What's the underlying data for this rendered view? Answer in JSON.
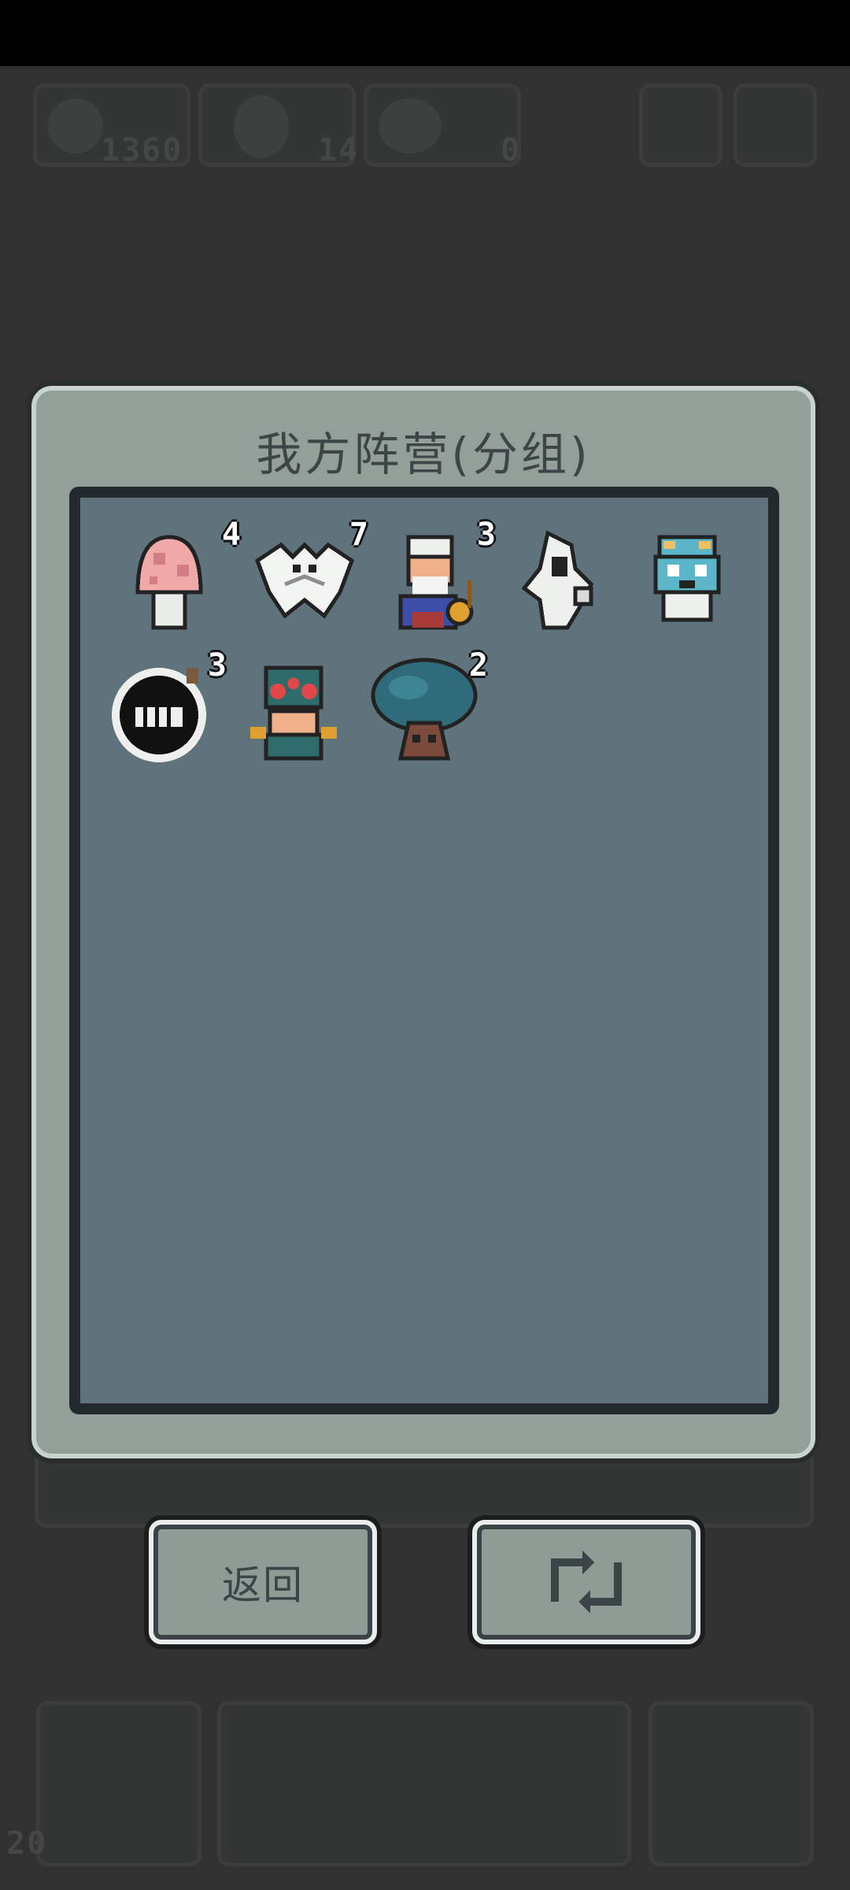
{
  "hud": {
    "resource_1": "1360",
    "resource_2": "14",
    "resource_3": "0",
    "turn_counter": "20"
  },
  "modal": {
    "title": "我方阵营(分组)"
  },
  "units": [
    {
      "name": "pink-mushroom",
      "count": "4"
    },
    {
      "name": "white-bat-spirit",
      "count": "7"
    },
    {
      "name": "old-bard",
      "count": "3"
    },
    {
      "name": "white-ghost-warrior",
      "count": ""
    },
    {
      "name": "blue-fish-creature",
      "count": ""
    },
    {
      "name": "black-bomb",
      "count": "3"
    },
    {
      "name": "teal-spider-mage",
      "count": ""
    },
    {
      "name": "blue-tree",
      "count": "2"
    }
  ],
  "buttons": {
    "back_label": "返回",
    "refresh_icon": "refresh-icon"
  },
  "colors": {
    "modal_bg": "#939f99",
    "panel_bg": "#5f737c",
    "page_bg": "#313131"
  }
}
